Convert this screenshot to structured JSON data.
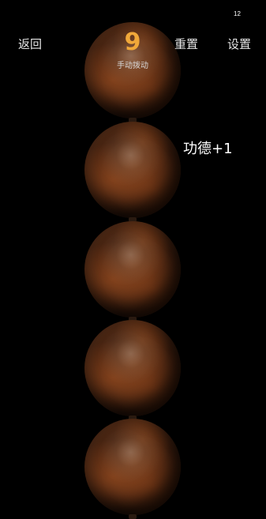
{
  "status_bar": {
    "time": "12"
  },
  "header": {
    "back_label": "返回",
    "reset_label": "重置",
    "settings_label": "设置"
  },
  "counter": {
    "value": "9",
    "mode": "手动拨动",
    "accent_color": "#f0a83a"
  },
  "merit": {
    "text": "功德+1"
  },
  "beads": {
    "count_visible": 5,
    "color": "#4a2512"
  }
}
